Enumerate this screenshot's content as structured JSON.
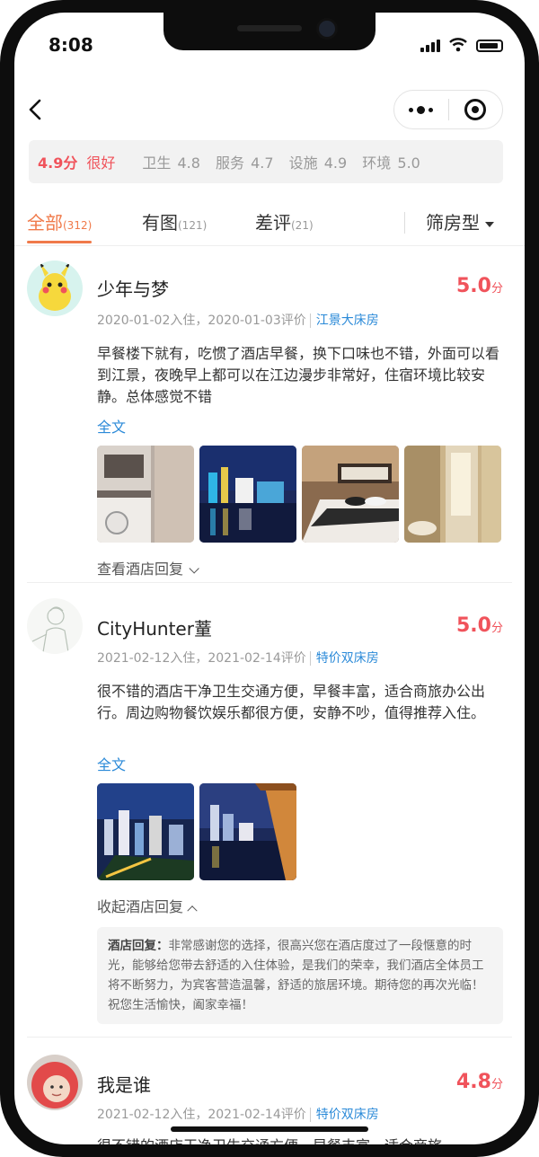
{
  "status": {
    "time": "8:08"
  },
  "score_bar": {
    "overall": "4.9分",
    "overall_word": "很好",
    "items": [
      "卫生 4.8",
      "服务 4.7",
      "设施 4.9",
      "环境 5.0"
    ]
  },
  "tabs": [
    {
      "label": "全部",
      "count": "(312)"
    },
    {
      "label": "有图",
      "count": "(121)"
    },
    {
      "label": "差评",
      "count": "(21)"
    }
  ],
  "filter": {
    "label": "筛房型"
  },
  "reviews": [
    {
      "name": "少年与梦",
      "rating": "5.0",
      "rating_unit": "分",
      "dates": "2020-01-02入住，2020-01-03评价",
      "room": "江景大床房",
      "text": "早餐楼下就有，吃惯了酒店早餐，换下口味也不错，外面可以看到江景，夜晚早上都可以在江边漫步非常好，住宿环境比较安静。总体感觉不错",
      "fulltext": "全文",
      "reply_toggle": "查看酒店回复"
    },
    {
      "name": "CityHunter蕫",
      "rating": "5.0",
      "rating_unit": "分",
      "dates": "2021-02-12入住，2021-02-14评价",
      "room": "特价双床房",
      "text": "很不错的酒店干净卫生交通方便，早餐丰富，适合商旅办公出行。周边购物餐饮娱乐都很方便，安静不吵，值得推荐入住。",
      "fulltext": "全文",
      "reply_toggle": "收起酒店回复",
      "reply_label": "酒店回复：",
      "reply_text": "非常感谢您的选择，很高兴您在酒店度过了一段惬意的时光，能够给您带去舒适的入住体验，是我们的荣幸，我们酒店全体员工将不断努力，为宾客营造温馨，舒适的旅居环境。期待您的再次光临！祝您生活愉快，阖家幸福！"
    },
    {
      "name": "我是谁",
      "rating": "4.8",
      "rating_unit": "分",
      "dates": "2021-02-12入住，2021-02-14评价",
      "room": "特价双床房",
      "text": "很不错的酒店干净卫生交通方便，早餐丰富，适合商旅"
    }
  ],
  "colors": {
    "accent": "#f07a4a",
    "rating": "#f0535b",
    "link": "#2b8ad8"
  }
}
